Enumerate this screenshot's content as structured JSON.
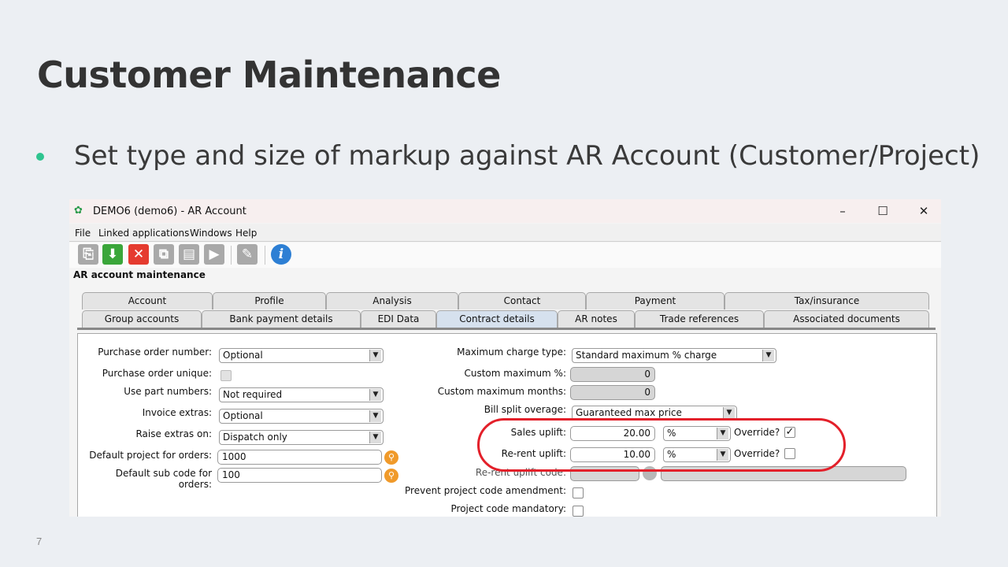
{
  "slide": {
    "title": "Customer Maintenance",
    "bullet": "Set type and size of markup against AR Account (Customer/Project)",
    "page_number": "7"
  },
  "window": {
    "title": "DEMO6 (demo6) - AR Account",
    "minimize": "–",
    "maximize": "☐",
    "close": "✕"
  },
  "menu": [
    "File",
    "Linked applications",
    "Windows",
    "Help"
  ],
  "section_title": "AR account maintenance",
  "tabs_row1": [
    "Account",
    "Profile",
    "Analysis",
    "Contact",
    "Payment",
    "Tax/insurance"
  ],
  "tabs_row2": [
    "Group accounts",
    "Bank payment details",
    "EDI Data",
    "Contract details",
    "AR notes",
    "Trade references",
    "Associated documents"
  ],
  "active_tab": "Contract details",
  "form_left": {
    "po_number": {
      "label": "Purchase order number:",
      "value": "Optional"
    },
    "po_unique": {
      "label": "Purchase order unique:",
      "checked": false
    },
    "use_part_numbers": {
      "label": "Use part numbers:",
      "value": "Not required"
    },
    "invoice_extras": {
      "label": "Invoice extras:",
      "value": "Optional"
    },
    "raise_extras_on": {
      "label": "Raise extras on:",
      "value": "Dispatch only"
    },
    "default_project": {
      "label": "Default project for orders:",
      "value": "1000"
    },
    "default_sub_code": {
      "label": "Default sub code for orders:",
      "value": "100"
    }
  },
  "form_right": {
    "max_charge_type": {
      "label": "Maximum charge type:",
      "value": "Standard maximum % charge"
    },
    "custom_max_pct": {
      "label": "Custom maximum %:",
      "value": "0"
    },
    "custom_max_months": {
      "label": "Custom maximum months:",
      "value": "0"
    },
    "bill_split_overage": {
      "label": "Bill split overage:",
      "value": "Guaranteed max price"
    },
    "sales_uplift": {
      "label": "Sales uplift:",
      "value": "20.00",
      "type": "%",
      "override_label": "Override?",
      "override": true
    },
    "rerent_uplift": {
      "label": "Re-rent uplift:",
      "value": "10.00",
      "type": "%",
      "override_label": "Override?",
      "override": false
    },
    "rerent_uplift_code": {
      "label": "Re-rent uplift code:"
    },
    "prevent_amendment": {
      "label": "Prevent project code amendment:",
      "checked": false
    },
    "project_code_mandatory": {
      "label": "Project code mandatory:",
      "checked": false
    }
  },
  "colors": {
    "accent_bullet": "#2ec48f",
    "highlight": "#e3202a",
    "active_tab": "#d6e1ee"
  }
}
